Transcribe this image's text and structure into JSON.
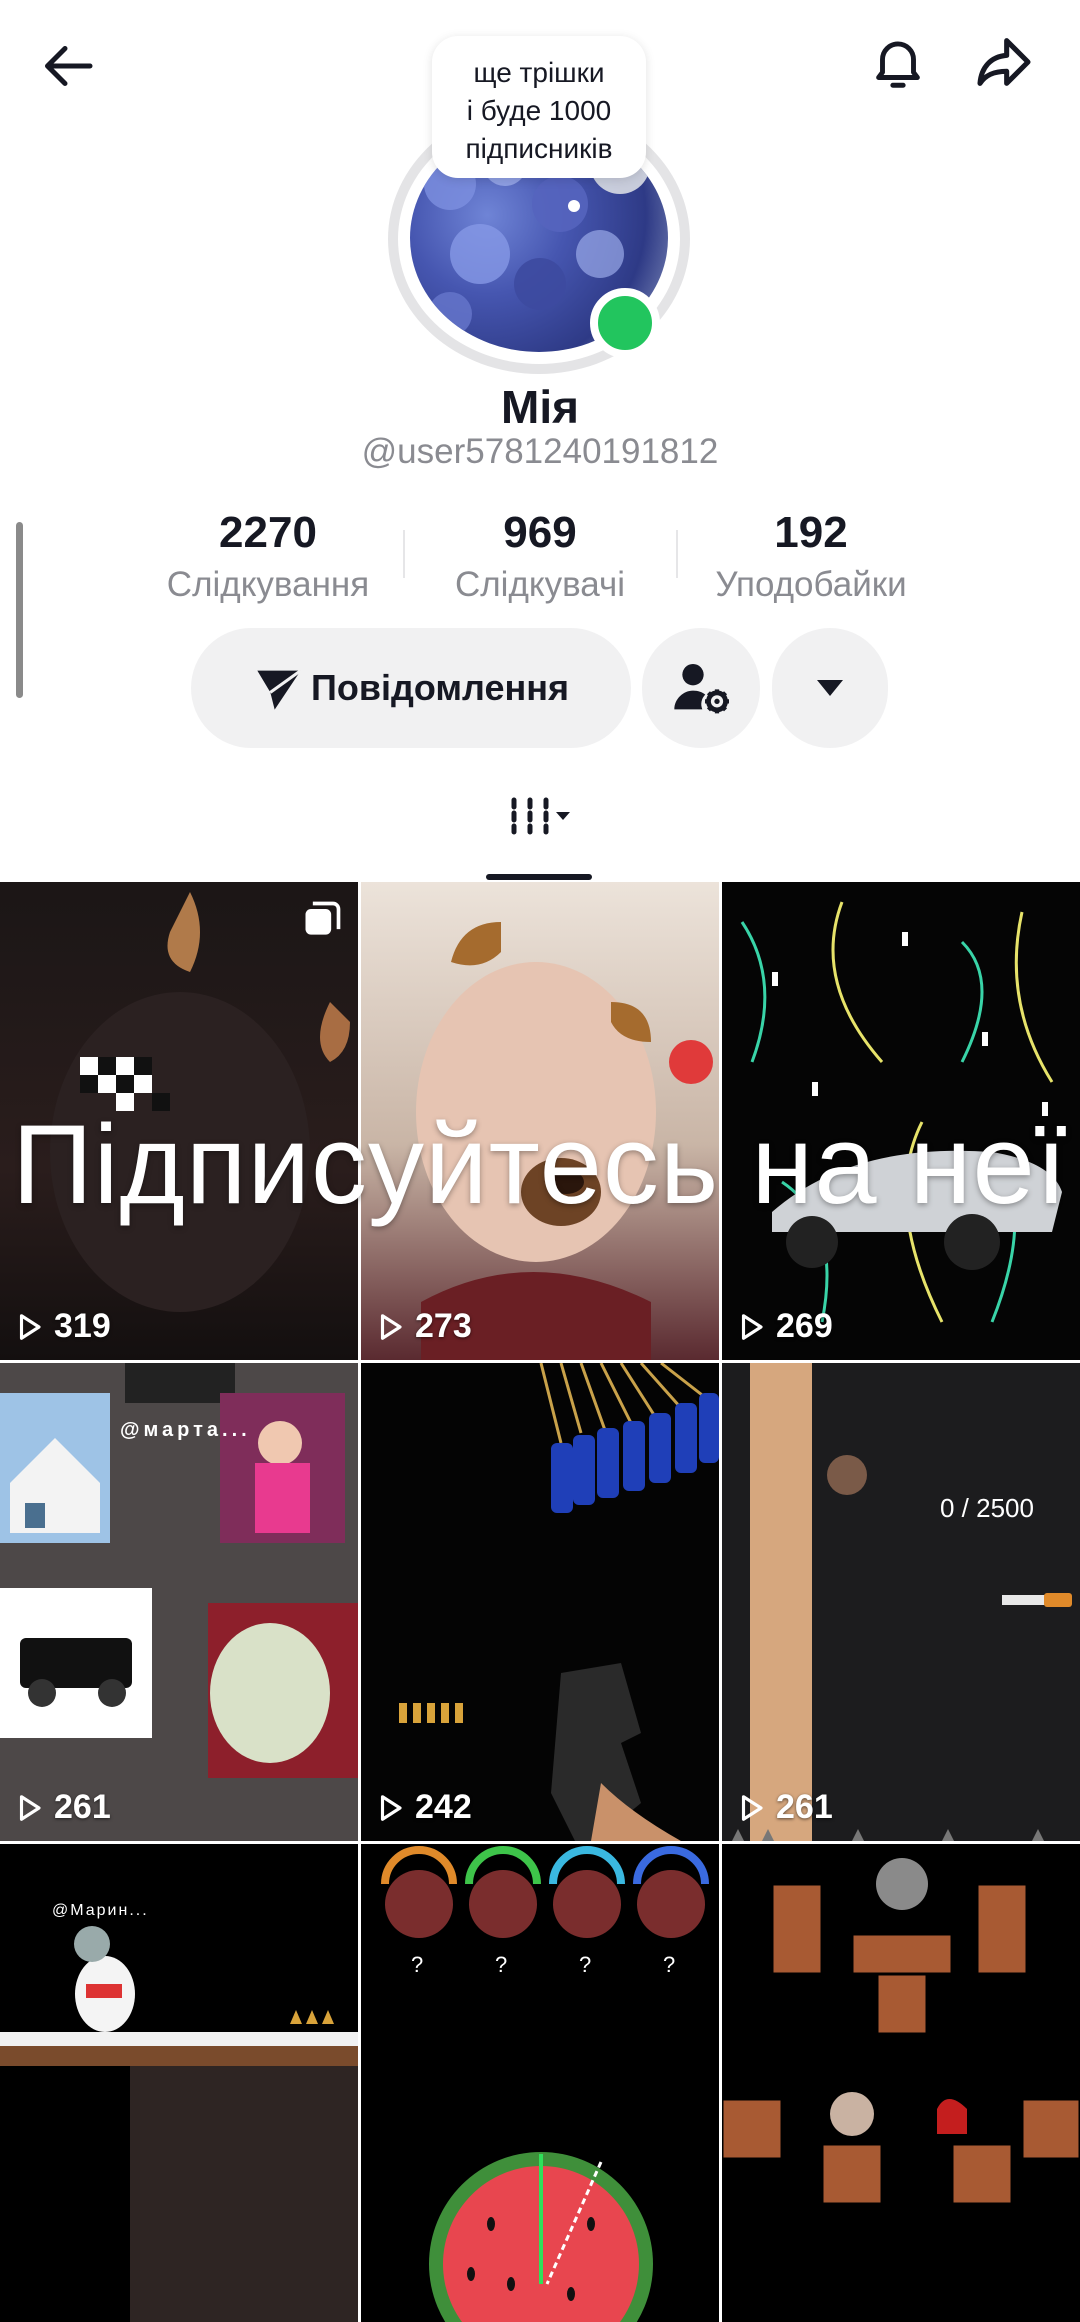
{
  "header": {
    "back_icon": "arrow-left-icon",
    "bell_icon": "bell-icon",
    "share_icon": "share-icon"
  },
  "profile": {
    "bubble_text_line1": "ще трішки",
    "bubble_text_line2": "і буде 1000",
    "bubble_text_line3": "підписників",
    "name": "Мія",
    "username": "@user5781240191812",
    "online_color": "#22c55e"
  },
  "stats": [
    {
      "value": "2270",
      "label": "Слідкування"
    },
    {
      "value": "969",
      "label": "Слідкувачі"
    },
    {
      "value": "192",
      "label": "Уподобайки"
    }
  ],
  "actions": {
    "message_label": "Повідомлення",
    "message_icon": "paper-plane-icon",
    "user_settings_icon": "user-gear-icon",
    "dropdown_icon": "caret-down-icon"
  },
  "tabs": {
    "videos_icon": "videos-grid-icon"
  },
  "overlay": {
    "text": "Підписуйтесь на неї"
  },
  "videos": [
    {
      "views": "319"
    },
    {
      "views": "273"
    },
    {
      "views": "269"
    },
    {
      "views": "261"
    },
    {
      "views": "242"
    },
    {
      "views": "261",
      "score_text": "0 / 2500"
    },
    {
      "views": "",
      "tag_text": "@Марин..."
    },
    {
      "views": ""
    },
    {
      "views": ""
    }
  ],
  "video_tags": {
    "marta_tag": "@мартa..."
  }
}
